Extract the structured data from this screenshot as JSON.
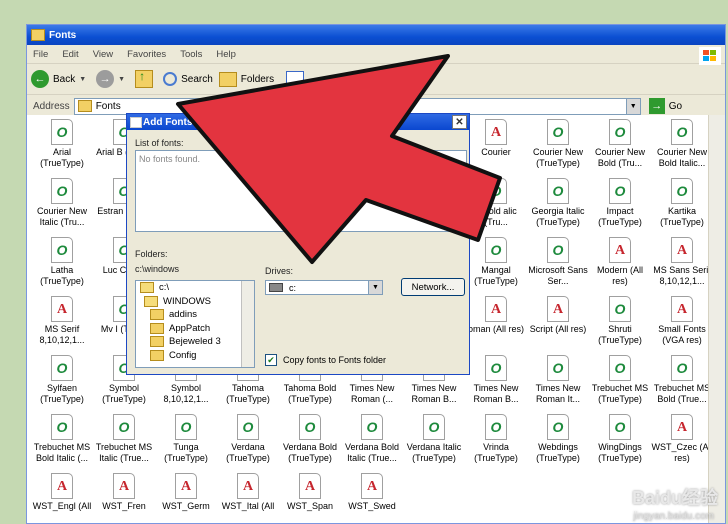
{
  "window": {
    "title": "Fonts",
    "menu": [
      "File",
      "Edit",
      "View",
      "Favorites",
      "Tools",
      "Help"
    ],
    "toolbar": {
      "back": "Back",
      "search": "Search",
      "folders": "Folders"
    },
    "address": {
      "label": "Address",
      "value": "Fonts",
      "go": "Go"
    }
  },
  "fonts": [
    {
      "icon": "o",
      "label": "Arial (TrueType)"
    },
    {
      "icon": "o",
      "label": "Arial B (TrueT"
    },
    {
      "icon": "a",
      "label": "Courier"
    },
    {
      "icon": "o",
      "label": "Courier New (TrueType)"
    },
    {
      "icon": "o",
      "label": "Courier New Bold (Tru..."
    },
    {
      "icon": "o",
      "label": "Courier New Bold Italic..."
    },
    {
      "icon": "o",
      "label": "Courier New Italic (Tru..."
    },
    {
      "icon": "o",
      "label": "Estran Edess"
    },
    {
      "icon": "o",
      "label": "a Bold alic (Tru..."
    },
    {
      "icon": "o",
      "label": "Georgia Italic (TrueType)"
    },
    {
      "icon": "o",
      "label": "Impact (TrueType)"
    },
    {
      "icon": "o",
      "label": "Kartika (TrueType)"
    },
    {
      "icon": "o",
      "label": "Latha (TrueType)"
    },
    {
      "icon": "o",
      "label": "Luc Consc"
    },
    {
      "icon": "o",
      "label": "Mangal (TrueType)"
    },
    {
      "icon": "o",
      "label": "Microsoft Sans Ser..."
    },
    {
      "icon": "a",
      "label": "Modern (All res)"
    },
    {
      "icon": "a",
      "label": "MS Sans Serif 8,10,12,1..."
    },
    {
      "icon": "a",
      "label": "MS Serif 8,10,12,1..."
    },
    {
      "icon": "o",
      "label": "Mv I (TrueT"
    },
    {
      "icon": "a",
      "label": "oman (All res)"
    },
    {
      "icon": "a",
      "label": "Script (All res)"
    },
    {
      "icon": "o",
      "label": "Shruti (TrueType)"
    },
    {
      "icon": "a",
      "label": "Small Fonts (VGA res)"
    },
    {
      "icon": "o",
      "label": "Sylfaen (TrueType)"
    },
    {
      "icon": "o",
      "label": "Symbol (TrueType)"
    },
    {
      "icon": "a",
      "label": "Symbol 8,10,12,1..."
    },
    {
      "icon": "o",
      "label": "Tahoma (TrueType)"
    },
    {
      "icon": "o",
      "label": "Tahoma Bold (TrueType)"
    },
    {
      "icon": "o",
      "label": "Times New Roman (..."
    },
    {
      "icon": "o",
      "label": "Times New Roman B..."
    },
    {
      "icon": "o",
      "label": "Times New Roman B..."
    },
    {
      "icon": "o",
      "label": "Times New Roman It..."
    },
    {
      "icon": "o",
      "label": "Trebuchet MS (TrueType)"
    },
    {
      "icon": "o",
      "label": "Trebuchet MS Bold (True..."
    },
    {
      "icon": "o",
      "label": "Trebuchet MS Bold Italic (..."
    },
    {
      "icon": "o",
      "label": "Trebuchet MS Italic (True..."
    },
    {
      "icon": "o",
      "label": "Tunga (TrueType)"
    },
    {
      "icon": "o",
      "label": "Verdana (TrueType)"
    },
    {
      "icon": "o",
      "label": "Verdana Bold (TrueType)"
    },
    {
      "icon": "o",
      "label": "Verdana Bold Italic (True..."
    },
    {
      "icon": "o",
      "label": "Verdana Italic (TrueType)"
    },
    {
      "icon": "o",
      "label": "Vrinda (TrueType)"
    },
    {
      "icon": "o",
      "label": "Webdings (TrueType)"
    },
    {
      "icon": "o",
      "label": "WingDings (TrueType)"
    },
    {
      "icon": "a",
      "label": "WST_Czec (All res)"
    },
    {
      "icon": "a",
      "label": "WST_Engl (All"
    },
    {
      "icon": "a",
      "label": "WST_Fren"
    },
    {
      "icon": "a",
      "label": "WST_Germ"
    },
    {
      "icon": "a",
      "label": "WST_Ital (All"
    },
    {
      "icon": "a",
      "label": "WST_Span"
    },
    {
      "icon": "a",
      "label": "WST_Swed"
    }
  ],
  "dialog": {
    "title": "Add Fonts",
    "list_label": "List of fonts:",
    "list_empty": "No fonts found.",
    "folders_label": "Folders:",
    "folder_path": "c:\\windows",
    "tree": [
      {
        "label": "c:\\",
        "open": true
      },
      {
        "label": "WINDOWS",
        "open": true
      },
      {
        "label": "addins",
        "open": false
      },
      {
        "label": "AppPatch",
        "open": false
      },
      {
        "label": "Bejeweled 3",
        "open": false
      },
      {
        "label": "Config",
        "open": false
      }
    ],
    "drives_label": "Drives:",
    "drive": "c:",
    "select_all": "Select",
    "network": "Network...",
    "copy_checkbox": "Copy fonts to Fonts folder"
  },
  "watermark": {
    "brand": "Baidu经验",
    "url": "jingyan.baidu.com"
  },
  "colors": {
    "arrow": "#e3343f",
    "arrow_outline": "#111111",
    "title_blue": "#0b4fd2",
    "background": "#c5d9b2"
  }
}
